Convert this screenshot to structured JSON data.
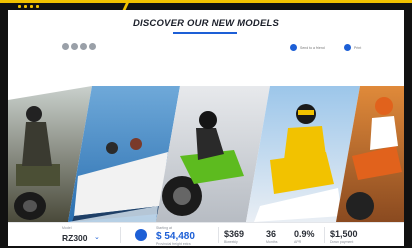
{
  "header": {
    "title": "DISCOVER OUR NEW MODELS"
  },
  "actions": {
    "share_label": "Send to a friend",
    "print_label": "Print"
  },
  "models": [
    {
      "name": "atv",
      "accent": "#3c4a2b"
    },
    {
      "name": "boat",
      "accent": "#3b7fbf"
    },
    {
      "name": "motorcycle",
      "accent": "#5dbb1f"
    },
    {
      "name": "snowmobile",
      "accent": "#f2c200"
    },
    {
      "name": "dirt-bike",
      "accent": "#e1621c"
    }
  ],
  "summary": {
    "model_label": "Model",
    "model_value": "RZ300",
    "price_label": "Starting at",
    "price_value": "$ 54,480",
    "price_sub": "Provincial freight extra",
    "payment_value": "$369",
    "payment_label": "Biweekly",
    "term_value": "36",
    "term_label": "Months",
    "rate_value": "0.9%",
    "rate_label": "APR",
    "down_value": "$1,500",
    "down_label": "Down payment"
  },
  "colors": {
    "accent": "#1d5fd6",
    "frame": "#f2c200"
  }
}
